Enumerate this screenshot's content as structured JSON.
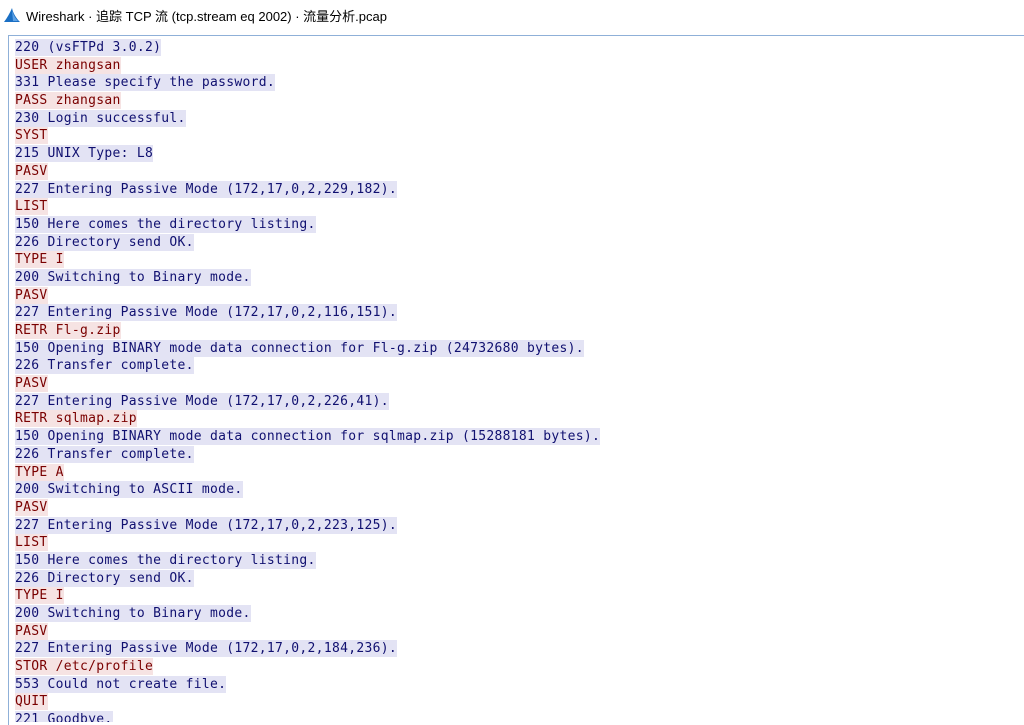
{
  "window": {
    "title": "Wireshark · 追踪 TCP 流 (tcp.stream eq 2002) · 流量分析.pcap",
    "icon": "wireshark-shark-fin-icon"
  },
  "colors": {
    "client_fg": "#7a0000",
    "client_bg": "#f6e3e3",
    "server_fg": "#101070",
    "server_bg": "#e3e3f4",
    "frame_border": "#8fb0d8",
    "icon_blue": "#1a6fc4"
  },
  "stream": {
    "lines": [
      {
        "dir": "server",
        "text": "220 (vsFTPd 3.0.2)"
      },
      {
        "dir": "client",
        "text": "USER zhangsan"
      },
      {
        "dir": "server",
        "text": "331 Please specify the password."
      },
      {
        "dir": "client",
        "text": "PASS zhangsan"
      },
      {
        "dir": "server",
        "text": "230 Login successful."
      },
      {
        "dir": "client",
        "text": "SYST"
      },
      {
        "dir": "server",
        "text": "215 UNIX Type: L8"
      },
      {
        "dir": "client",
        "text": "PASV"
      },
      {
        "dir": "server",
        "text": "227 Entering Passive Mode (172,17,0,2,229,182)."
      },
      {
        "dir": "client",
        "text": "LIST"
      },
      {
        "dir": "server",
        "text": "150 Here comes the directory listing."
      },
      {
        "dir": "server",
        "text": "226 Directory send OK."
      },
      {
        "dir": "client",
        "text": "TYPE I"
      },
      {
        "dir": "server",
        "text": "200 Switching to Binary mode."
      },
      {
        "dir": "client",
        "text": "PASV"
      },
      {
        "dir": "server",
        "text": "227 Entering Passive Mode (172,17,0,2,116,151)."
      },
      {
        "dir": "client",
        "text": "RETR Fl-g.zip"
      },
      {
        "dir": "server",
        "text": "150 Opening BINARY mode data connection for Fl-g.zip (24732680 bytes)."
      },
      {
        "dir": "server",
        "text": "226 Transfer complete."
      },
      {
        "dir": "client",
        "text": "PASV"
      },
      {
        "dir": "server",
        "text": "227 Entering Passive Mode (172,17,0,2,226,41)."
      },
      {
        "dir": "client",
        "text": "RETR sqlmap.zip"
      },
      {
        "dir": "server",
        "text": "150 Opening BINARY mode data connection for sqlmap.zip (15288181 bytes)."
      },
      {
        "dir": "server",
        "text": "226 Transfer complete."
      },
      {
        "dir": "client",
        "text": "TYPE A"
      },
      {
        "dir": "server",
        "text": "200 Switching to ASCII mode."
      },
      {
        "dir": "client",
        "text": "PASV"
      },
      {
        "dir": "server",
        "text": "227 Entering Passive Mode (172,17,0,2,223,125)."
      },
      {
        "dir": "client",
        "text": "LIST"
      },
      {
        "dir": "server",
        "text": "150 Here comes the directory listing."
      },
      {
        "dir": "server",
        "text": "226 Directory send OK."
      },
      {
        "dir": "client",
        "text": "TYPE I"
      },
      {
        "dir": "server",
        "text": "200 Switching to Binary mode."
      },
      {
        "dir": "client",
        "text": "PASV"
      },
      {
        "dir": "server",
        "text": "227 Entering Passive Mode (172,17,0,2,184,236)."
      },
      {
        "dir": "client",
        "text": "STOR /etc/profile"
      },
      {
        "dir": "server",
        "text": "553 Could not create file."
      },
      {
        "dir": "client",
        "text": "QUIT"
      },
      {
        "dir": "server",
        "text": "221 Goodbye."
      }
    ]
  }
}
